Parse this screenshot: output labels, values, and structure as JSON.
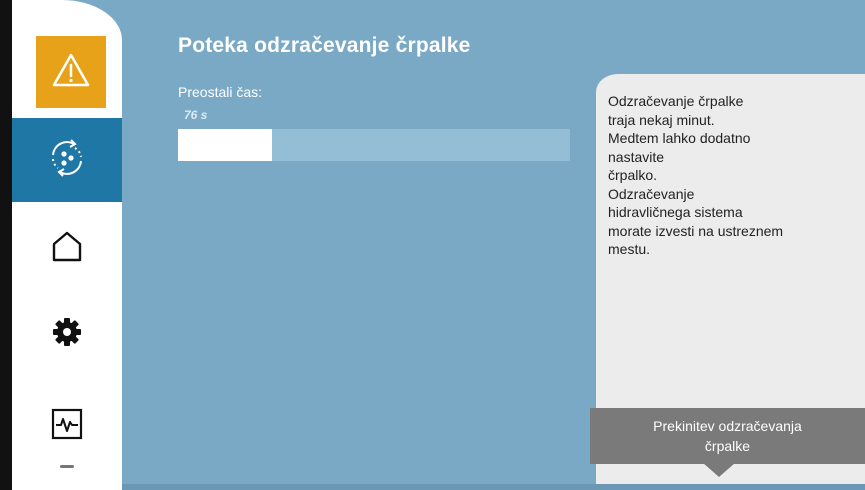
{
  "screen": {
    "title": "Poteka odzračevanje črpalke"
  },
  "sidebar": {
    "items": [
      {
        "name": "warning",
        "icon": "warning-icon",
        "color": "#e8a21a"
      },
      {
        "name": "venting",
        "icon": "pump-venting-icon",
        "active": true,
        "color": "#1f77a6"
      },
      {
        "name": "home",
        "icon": "home-icon"
      },
      {
        "name": "settings",
        "icon": "gear-icon"
      },
      {
        "name": "diagnostics",
        "icon": "diagnostics-icon"
      },
      {
        "name": "more",
        "icon": "chevron-down-icon"
      }
    ]
  },
  "progress": {
    "label": "Preostali čas:",
    "value_text": "76 s",
    "fraction": 0.24
  },
  "info_panel": {
    "text": "Odzračevanje črpalke\ntraja nekaj minut.\nMedtem lahko dodatno\nnastavite\nčrpalko.\nOdzračevanje\nhidravličnega sistema\nmorate izvesti na ustreznem\nmestu."
  },
  "action": {
    "label": "Prekinitev odzračevanja\nčrpalke"
  }
}
